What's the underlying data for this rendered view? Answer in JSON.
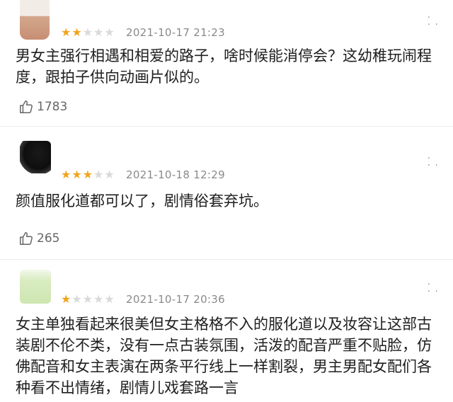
{
  "reviews": [
    {
      "stars": 2,
      "time": "2021-10-17 21:23",
      "content": "男女主强行相遇和相爱的路子，啥时候能消停会？这幼稚玩闹程度，跟拍子供向动画片似的。",
      "likes": "1783"
    },
    {
      "stars": 3,
      "time": "2021-10-18 12:29",
      "content": "颜值服化道都可以了，剧情俗套弃坑。",
      "likes": "265"
    },
    {
      "stars": 1,
      "time": "2021-10-17 20:36",
      "content": "女主单独看起来很美但女主格格不入的服化道以及妆容让这部古装剧不伦不类，没有一点古装氛围，活泼的配音严重不贴脸，仿佛配音和女主表演在两条平行线上一样割裂，男主男配女配们各种看不出情绪，剧情儿戏套路一言"
    }
  ],
  "icons": {
    "star": "star-icon",
    "more": "more-dots-icon",
    "like": "thumbs-up-icon"
  },
  "colors": {
    "star_on": "#f2a41a",
    "star_off": "#d9d9d9",
    "time": "#8a8a8a"
  }
}
